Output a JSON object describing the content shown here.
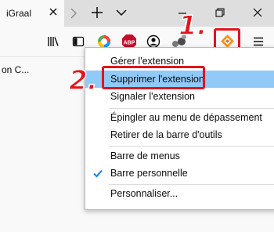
{
  "tab": {
    "title": "iGraal"
  },
  "bookmarks": {
    "item_label": "on C..."
  },
  "context_menu": {
    "items": [
      {
        "label": "Gérer l'extension"
      },
      {
        "label": "Supprimer l'extension"
      },
      {
        "label": "Signaler l'extension"
      },
      {
        "label": "Épingler au menu de dépassement"
      },
      {
        "label": "Retirer de la barre d'outils"
      },
      {
        "label": "Barre de menus"
      },
      {
        "label": "Barre personnelle",
        "checked": true
      },
      {
        "label": "Personnaliser..."
      }
    ]
  },
  "annotations": {
    "step1": "1.",
    "step2": "2."
  },
  "colors": {
    "highlight": "#91c9f7",
    "annotation": "#e3141b",
    "accent_blue": "#0a84ff"
  },
  "icons": [
    "close-icon",
    "tab-scroll-right-icon",
    "new-tab-icon",
    "tab-list-icon",
    "minimize-icon",
    "restore-icon",
    "window-close-icon",
    "library-icon",
    "sidebar-icon",
    "color-extension-icon",
    "adblock-plus-icon",
    "account-icon",
    "bubbles-extension-icon",
    "igraal-extension-icon",
    "hamburger-menu-icon",
    "checkmark-icon"
  ]
}
